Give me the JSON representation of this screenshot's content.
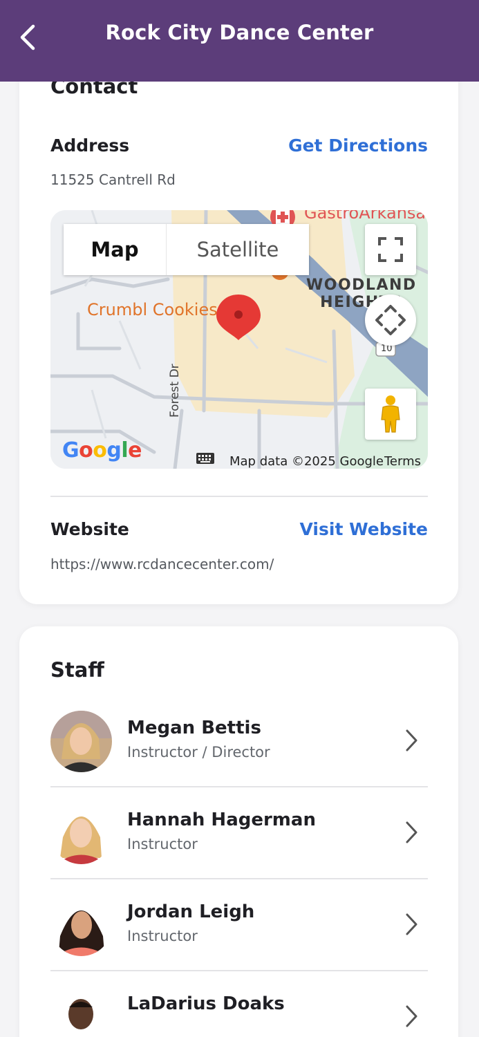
{
  "header": {
    "title": "Rock City Dance Center",
    "back_icon": "chevron-left-icon"
  },
  "contact": {
    "title": "Contact",
    "address_label": "Address",
    "address_value": "11525 Cantrell Rd",
    "directions_link": "Get Directions",
    "website_label": "Website",
    "website_value": "https://www.rcdancecenter.com/",
    "website_link": "Visit Website"
  },
  "map": {
    "tab_map": "Map",
    "tab_satellite": "Satellite",
    "poi_label": "Crumbl Cookies",
    "top_poi_label": "GastroArkansas Little Rock",
    "neighborhood_line1": "WOODLAND",
    "neighborhood_line2": "HEIGHTS",
    "street_label": "Forest Dr",
    "street_label_2": "Forest Dr",
    "route_shield": "10",
    "brand": "Google",
    "attribution": "Map data ©2025 Google",
    "terms": "Terms",
    "colors": {
      "pin": "#e53935",
      "poi": "#e0742a",
      "park": "#d7efdc",
      "zone": "#f7e9c8",
      "river": "#8ea4c2"
    }
  },
  "staff": {
    "title": "Staff",
    "members": [
      {
        "name": "Megan Bettis",
        "role": "Instructor / Director"
      },
      {
        "name": "Hannah Hagerman",
        "role": "Instructor"
      },
      {
        "name": "Jordan Leigh",
        "role": "Instructor"
      },
      {
        "name": "LaDarius Doaks",
        "role": ""
      }
    ]
  },
  "colors": {
    "header_bg": "#5c3d7a",
    "link": "#2f6fd6",
    "page_bg": "#f4f4f6"
  }
}
